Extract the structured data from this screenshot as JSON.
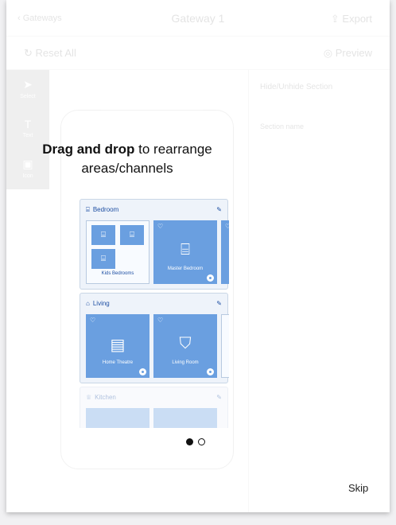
{
  "app": {
    "back_label": "Gateways",
    "title": "Gateway 1",
    "export_label": "Export",
    "reset_label": "Reset All",
    "preview_label": "Preview",
    "tools": [
      {
        "icon": "cursor-icon",
        "label": "Select"
      },
      {
        "icon": "text-icon",
        "label": "Text"
      },
      {
        "icon": "image-icon",
        "label": "Icon"
      }
    ],
    "right_panel": {
      "toggle_label": "Hide/Unhide Section",
      "section_label": "Section name"
    }
  },
  "onboarding": {
    "headline_bold": "Drag and drop",
    "headline_rest": " to rearrange areas/channels",
    "skip_label": "Skip",
    "page_count": 2,
    "current_page": 1
  },
  "sections": [
    {
      "title": "Bedroom",
      "icon": "bed-icon",
      "group": {
        "name": "Kids Bedrooms"
      },
      "tile": {
        "name": "Master Bedroom",
        "icon": "bed-icon"
      }
    },
    {
      "title": "Living",
      "icon": "sofa-icon",
      "tiles": [
        {
          "name": "Home Theatre",
          "icon": "tv-icon"
        },
        {
          "name": "Living Room",
          "icon": "lamp-icon"
        }
      ]
    },
    {
      "title": "Kitchen",
      "icon": "chef-icon"
    }
  ],
  "colors": {
    "accent": "#1e4fa3",
    "tile": "#6a9fe0",
    "section_bg": "#eef3fa"
  }
}
